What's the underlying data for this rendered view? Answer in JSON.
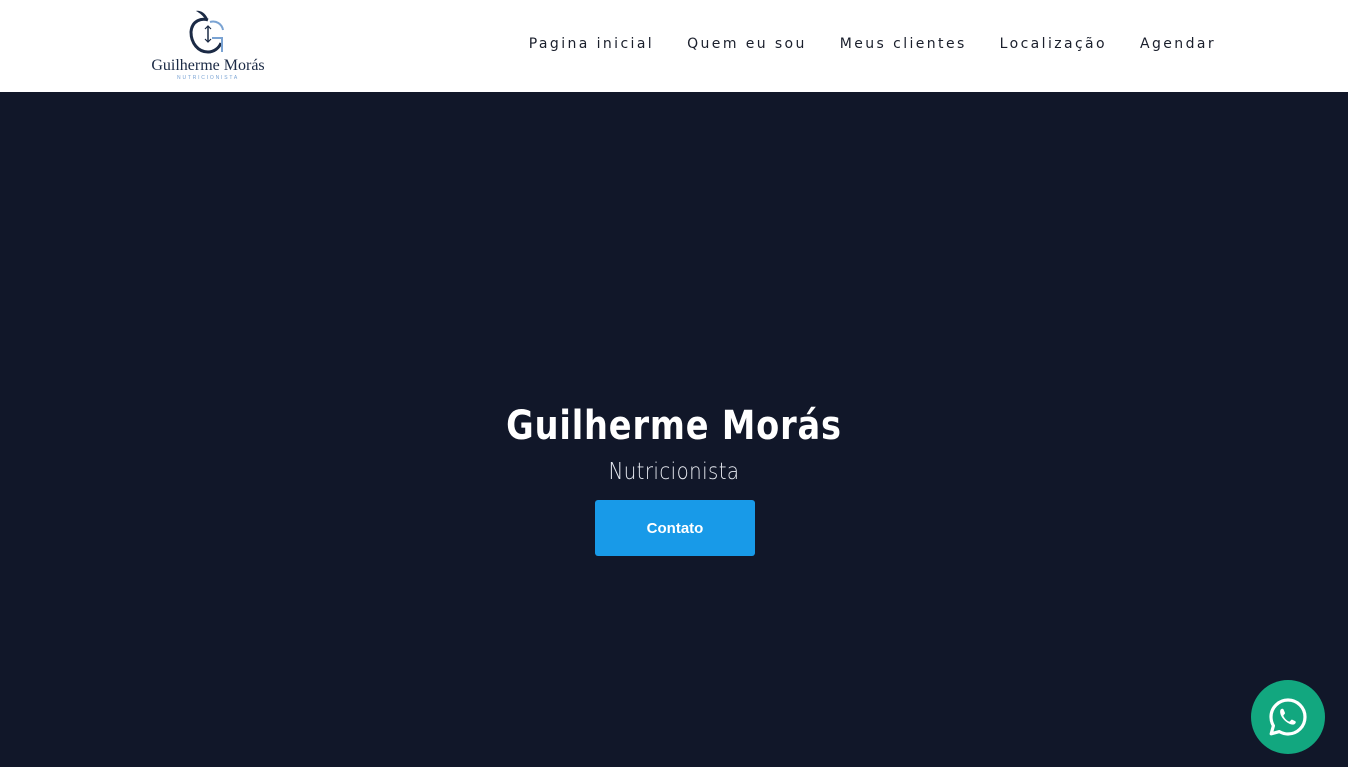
{
  "header": {
    "logo": {
      "name": "Guilherme Morás",
      "tagline": "NUTRICIONISTA",
      "icon": "apple-g-icon"
    },
    "nav": [
      {
        "label": "Pagina inicial"
      },
      {
        "label": "Quem eu sou"
      },
      {
        "label": "Meus clientes"
      },
      {
        "label": "Localização"
      },
      {
        "label": "Agendar"
      }
    ]
  },
  "hero": {
    "title": "Guilherme Morás",
    "subtitle": "Nutricionista",
    "cta_label": "Contato"
  },
  "floating": {
    "icon": "whatsapp-icon"
  },
  "colors": {
    "header_bg": "#ffffff",
    "hero_bg": "#111729",
    "cta_bg": "#189ae8",
    "whatsapp_bg": "#12a77f"
  }
}
